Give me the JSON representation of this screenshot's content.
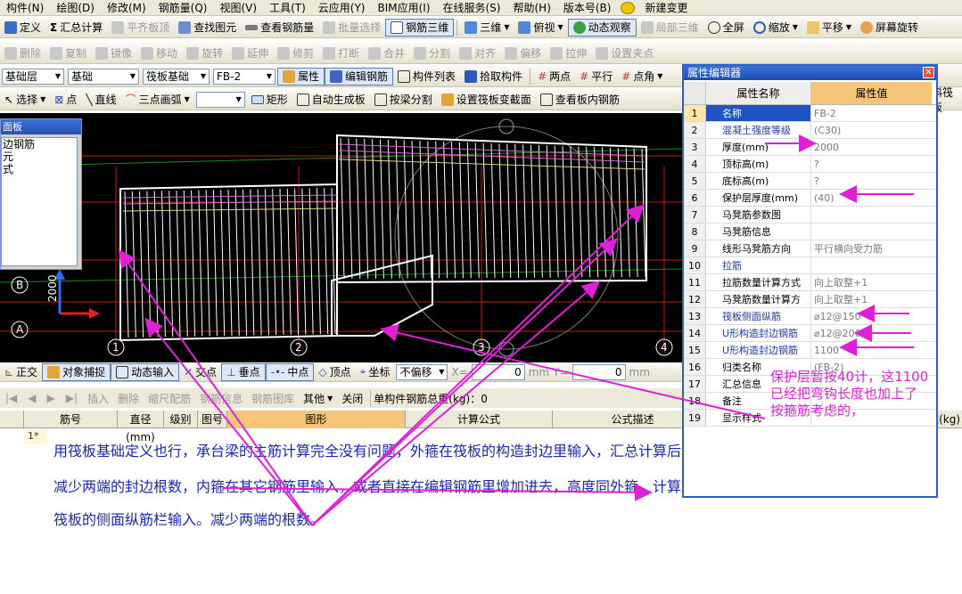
{
  "menu": [
    "构件(N)",
    "绘图(D)",
    "修改(M)",
    "钢筋量(Q)",
    "视图(V)",
    "工具(T)",
    "云应用(Y)",
    "BIM应用(I)",
    "在线服务(S)",
    "帮助(H)",
    "版本号(B)",
    "新建变更"
  ],
  "toolbar1": [
    "定义",
    "汇总计算",
    "平齐板顶",
    "查找图元",
    "查看钢筋量",
    "批量选择",
    "钢筋三维",
    "三维",
    "俯视",
    "动态观察",
    "局部三维",
    "全屏",
    "缩放",
    "平移",
    "屏幕旋转"
  ],
  "toolbar2": [
    "删除",
    "复制",
    "镜像",
    "移动",
    "旋转",
    "延伸",
    "修剪",
    "打断",
    "合并",
    "分割",
    "对齐",
    "偏移",
    "拉伸",
    "设置夹点"
  ],
  "toolbar3": {
    "layer": "基础层",
    "type": "基础",
    "category": "筏板基础",
    "element": "FB-2",
    "buttons": [
      "属性",
      "编辑钢筋",
      "构件列表",
      "拾取构件",
      "两点",
      "平行",
      "点角"
    ]
  },
  "toolbar4": [
    "选择",
    "点",
    "直线",
    "三点画弧",
    "矩形",
    "自动生成板",
    "按梁分割",
    "设置筏板变截面",
    "查看板内钢筋",
    "斜筏板"
  ],
  "left_panel": {
    "title": "面板",
    "items": [
      "边钢筋",
      "元",
      "式"
    ]
  },
  "canvas": {
    "axis_labels": [
      "B",
      "1",
      "2",
      "3",
      "4",
      "A"
    ],
    "y_value": "2000"
  },
  "snap_bar": {
    "buttons": [
      "正交",
      "对象捕捉",
      "动态输入",
      "交点",
      "垂点",
      "中点",
      "顶点",
      "坐标"
    ],
    "offset": "不偏移",
    "x_label": "X=",
    "x_value": "0",
    "y_label": "Y=",
    "y_value": "0",
    "unit": "mm"
  },
  "rebar_bar": {
    "items": [
      "插入",
      "删除",
      "缩尺配筋",
      "钢筋信息",
      "钢筋图库",
      "其他",
      "关闭"
    ],
    "weight": "单构件钢筋总重(kg)：0"
  },
  "grid": {
    "columns": [
      "筋号",
      "直径(mm)",
      "级别",
      "图号",
      "图形",
      "计算公式",
      "公式描述"
    ],
    "last_col": "重(kg)",
    "row": "1*"
  },
  "notes": [
    "用筏板基础定义也行，承台梁的主筋计算完全没有问题，外箍在筏板的构造封边里输入，汇总计算后增加局部长度，",
    "减少两端的封边根数，内箍在其它钢筋里输入，或者直接在编辑钢筋里增加进去，高度同外箍，计算好肢距，侧面钢筋在",
    "筏板的侧面纵筋栏输入。减少两端的根数。"
  ],
  "prop_editor": {
    "title": "属性编辑器",
    "header": {
      "name": "属性名称",
      "value": "属性值"
    },
    "rows": [
      {
        "n": "1",
        "k": "名称",
        "v": "FB-2",
        "blue": true,
        "sel": true
      },
      {
        "n": "2",
        "k": "混凝土强度等级",
        "v": "(C30)",
        "blue": true
      },
      {
        "n": "3",
        "k": "厚度(mm)",
        "v": "2000",
        "blue": false
      },
      {
        "n": "4",
        "k": "顶标高(m)",
        "v": "?",
        "blue": false
      },
      {
        "n": "5",
        "k": "底标高(m)",
        "v": "?",
        "blue": false
      },
      {
        "n": "6",
        "k": "保护层厚度(mm)",
        "v": "(40)",
        "blue": false
      },
      {
        "n": "7",
        "k": "马凳筋参数图",
        "v": "",
        "blue": false
      },
      {
        "n": "8",
        "k": "马凳筋信息",
        "v": "",
        "blue": false
      },
      {
        "n": "9",
        "k": "线形马凳筋方向",
        "v": "平行横向受力筋",
        "blue": false
      },
      {
        "n": "10",
        "k": "拉筋",
        "v": "",
        "blue": true
      },
      {
        "n": "11",
        "k": "拉筋数量计算方式",
        "v": "向上取整+1",
        "blue": false
      },
      {
        "n": "12",
        "k": "马凳筋数量计算方",
        "v": "向上取整+1",
        "blue": false
      },
      {
        "n": "13",
        "k": "筏板侧面纵筋",
        "v": "⌀12@150",
        "blue": true
      },
      {
        "n": "14",
        "k": "U形构造封边钢筋",
        "v": "⌀12@200",
        "blue": true
      },
      {
        "n": "15",
        "k": "U形构造封边钢筋",
        "v": "1100",
        "blue": true
      },
      {
        "n": "16",
        "k": "归类名称",
        "v": "(FB-2)",
        "blue": false
      },
      {
        "n": "17",
        "k": "汇总信息",
        "v": "",
        "blue": false
      },
      {
        "n": "18",
        "k": "备注",
        "v": "",
        "blue": false
      },
      {
        "n": "19",
        "k": "显示样式",
        "v": "",
        "blue": false
      }
    ]
  },
  "annotation": [
    "保护层暂按40计，这1100",
    "已经把弯钩长度也加上了",
    "按箍筋考虑的，"
  ],
  "colors": {
    "accent": "#e020d8",
    "note": "#1a27b4",
    "titlebar": "#2d5fcf"
  }
}
